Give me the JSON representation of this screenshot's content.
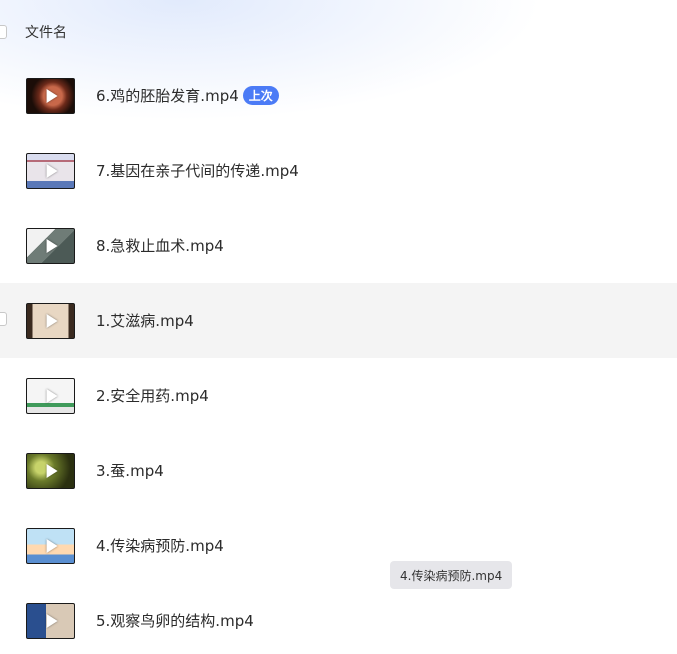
{
  "header": {
    "column_label": "文件名"
  },
  "files": [
    {
      "name": "6.鸡的胚胎发育.mp4",
      "badge": "上次",
      "thumb_icon": "video-thumbnail"
    },
    {
      "name": "7.基因在亲子代间的传递.mp4",
      "badge": "",
      "thumb_icon": "video-thumbnail"
    },
    {
      "name": "8.急救止血术.mp4",
      "badge": "",
      "thumb_icon": "video-thumbnail"
    },
    {
      "name": "1.艾滋病.mp4",
      "badge": "",
      "thumb_icon": "video-thumbnail"
    },
    {
      "name": "2.安全用药.mp4",
      "badge": "",
      "thumb_icon": "video-thumbnail"
    },
    {
      "name": "3.蚕.mp4",
      "badge": "",
      "thumb_icon": "video-thumbnail"
    },
    {
      "name": "4.传染病预防.mp4",
      "badge": "",
      "thumb_icon": "video-thumbnail"
    },
    {
      "name": "5.观察鸟卵的结构.mp4",
      "badge": "",
      "thumb_icon": "video-thumbnail"
    }
  ],
  "tooltip": {
    "text": "4.传染病预防.mp4"
  },
  "colors": {
    "badge": "#4b7bf6",
    "hover_row": "#f4f4f4"
  }
}
